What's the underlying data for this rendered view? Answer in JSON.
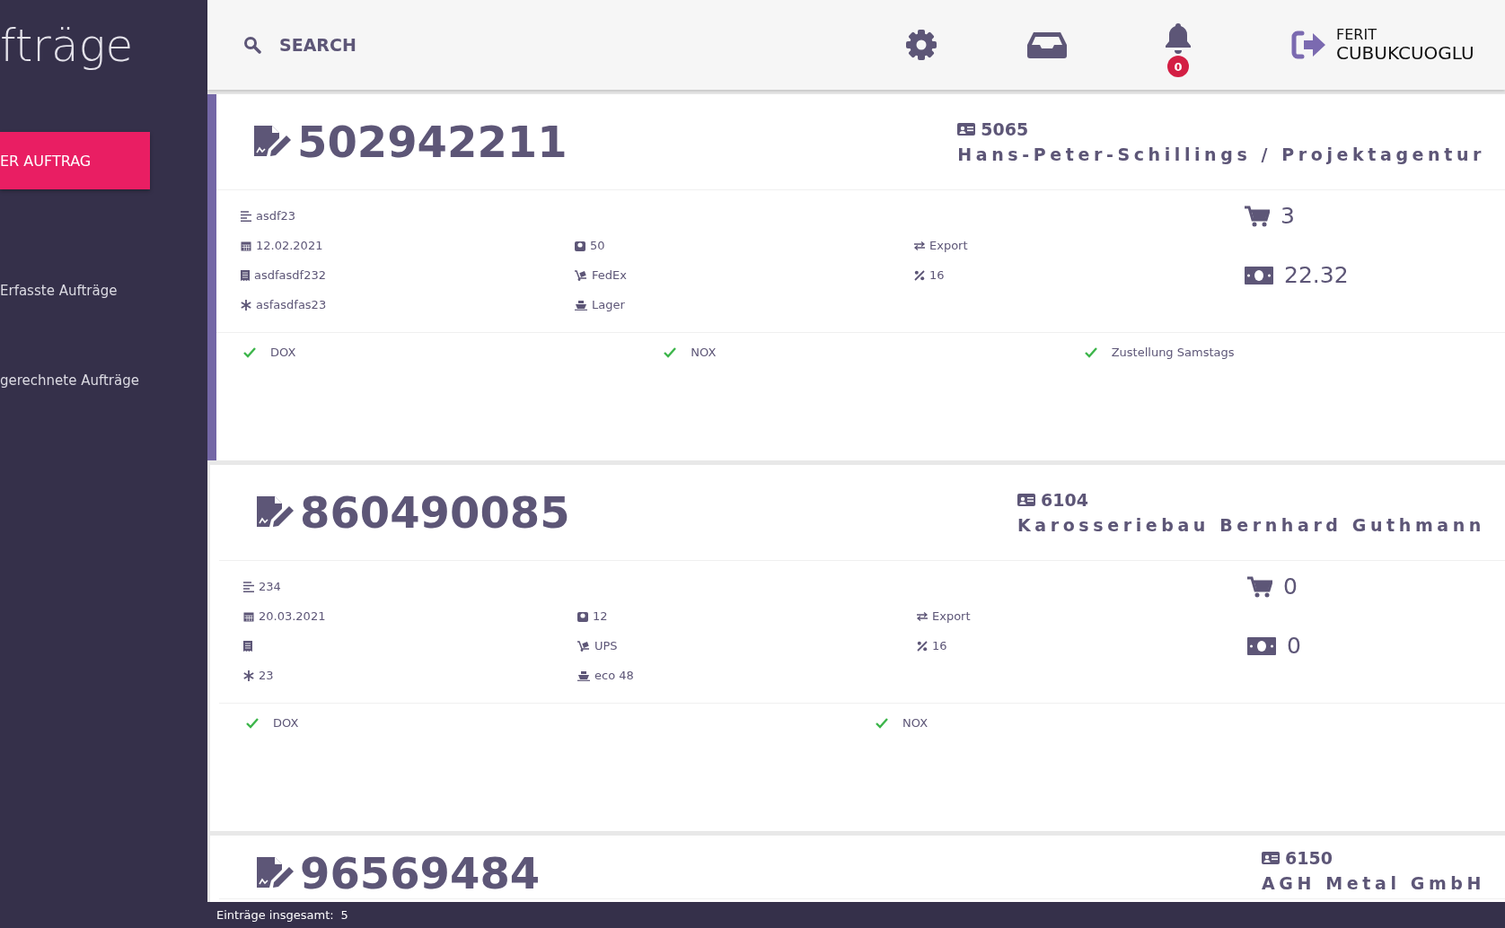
{
  "sidebar": {
    "title": "fträge",
    "new_button": "ER AUFTRAG",
    "items": [
      {
        "label": "Erfasste Aufträge"
      },
      {
        "label": "gerechnete Aufträge"
      }
    ]
  },
  "topbar": {
    "search": {
      "placeholder": "SEARCH"
    },
    "notifications": {
      "count": "0"
    },
    "user": {
      "first_name": "FERIT",
      "last_name": "CUBUKCUOGLU"
    }
  },
  "orders": [
    {
      "selected": true,
      "number": "502942211",
      "customer_id": "5065",
      "customer_name": "Hans-Peter-Schillings / Projektagentur",
      "reference": "asdf23",
      "date": "12.02.2021",
      "packages": "50",
      "direction": "Export",
      "invoice": "asdfasdf232",
      "carrier": "FedEx",
      "tax": "16",
      "code": "asfasdfas23",
      "warehouse": "Lager",
      "cart_count": "3",
      "amount": "22.32",
      "options": [
        {
          "label": "DOX",
          "checked": true
        },
        {
          "label": "NOX",
          "checked": true
        },
        {
          "label": "Zustellung Samstags",
          "checked": true
        }
      ]
    },
    {
      "selected": false,
      "number": "860490085",
      "customer_id": "6104",
      "customer_name": "Karosseriebau Bernhard Guthmann",
      "reference": "234",
      "date": "20.03.2021",
      "packages": "12",
      "direction": "Export",
      "carrier": "UPS",
      "tax": "16",
      "code": "23",
      "warehouse": "eco 48",
      "cart_count": "0",
      "amount": "0",
      "options": [
        {
          "label": "DOX",
          "checked": true
        },
        {
          "label": "NOX",
          "checked": true
        }
      ]
    },
    {
      "selected": false,
      "number": "96569484",
      "customer_id": "6150",
      "customer_name": "AGH Metal GmbH"
    }
  ],
  "status_bar": {
    "label": "Einträge insgesamt:",
    "total": "5"
  }
}
